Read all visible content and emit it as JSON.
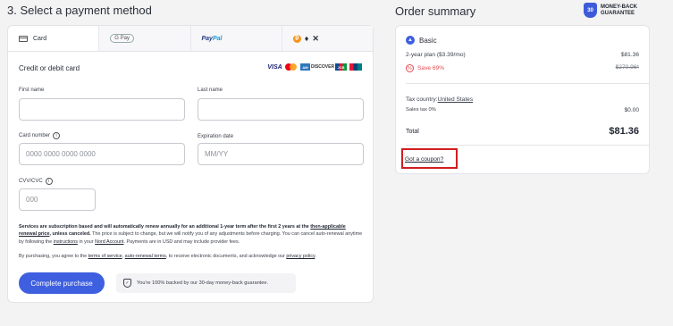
{
  "page": {
    "step_title": "3. Select a payment method",
    "order_title": "Order summary"
  },
  "badge": {
    "shield_text": "30",
    "shield_sub": "DAYS",
    "label": "MONEY-BACK GUARANTEE"
  },
  "tabs": [
    {
      "label": "Card",
      "icon": "credit-card-icon",
      "active": true
    },
    {
      "label": "G Pay",
      "icon": "google-pay-icon"
    },
    {
      "label": "PayPal",
      "icon": "paypal-icon"
    },
    {
      "label": "",
      "icon": "crypto-icons"
    }
  ],
  "card_form": {
    "section_label": "Credit or debit card",
    "brands": [
      "VISA",
      "Mastercard",
      "AMEX",
      "DISCOVER",
      "JCB",
      "UnionPay"
    ],
    "first_name_label": "First name",
    "last_name_label": "Last name",
    "card_number_label": "Card number",
    "card_number_placeholder": "0000 0000 0000 0000",
    "expiration_label": "Expiration date",
    "expiration_placeholder": "MM/YY",
    "cvv_label": "CVV/CVC",
    "cvv_placeholder": "000"
  },
  "terms": {
    "bold_text": "Services are subscription based and will automatically renew annually for an additional 1-year term after the first 2 years at the",
    "link_renewal": "then-applicable renewal price",
    "bold_tail": ", unless canceled.",
    "text_1": " The price is subject to change, but we will notify you of any adjustments before charging. You can cancel auto-renewal anytime by following the ",
    "link_instructions": "instructions",
    "text_2": " in your ",
    "link_account": "Nord Account",
    "text_3": ". Payments are in USD and may include provider fees.",
    "consent_1": "By purchasing, you agree to the ",
    "link_tos": "terms of service",
    "consent_2": ", ",
    "link_auto": "auto-renewal terms",
    "consent_3": ", to receive electronic documents, and acknowledge our ",
    "link_privacy": "privacy policy",
    "consent_4": "."
  },
  "actions": {
    "complete_label": "Complete purchase",
    "guarantee_text": "You're 100% backed by our 30-day money-back guarantee."
  },
  "summary": {
    "plan_name": "Basic",
    "plan_line": "2-year plan ($3.39/mo)",
    "plan_price": "$81.36",
    "save_label": "Save 69%",
    "original_price": "$270.96*",
    "tax_country_label": "Tax country: ",
    "tax_country": "United States",
    "sales_tax_label": "Sales tax 0%",
    "sales_tax_value": "$0.00",
    "total_label": "Total",
    "total_value": "$81.36",
    "coupon_label": "Got a coupon?"
  },
  "colors": {
    "accent": "#3e5fe0",
    "discount": "#e5484d",
    "highlight_box": "#d21d20"
  }
}
